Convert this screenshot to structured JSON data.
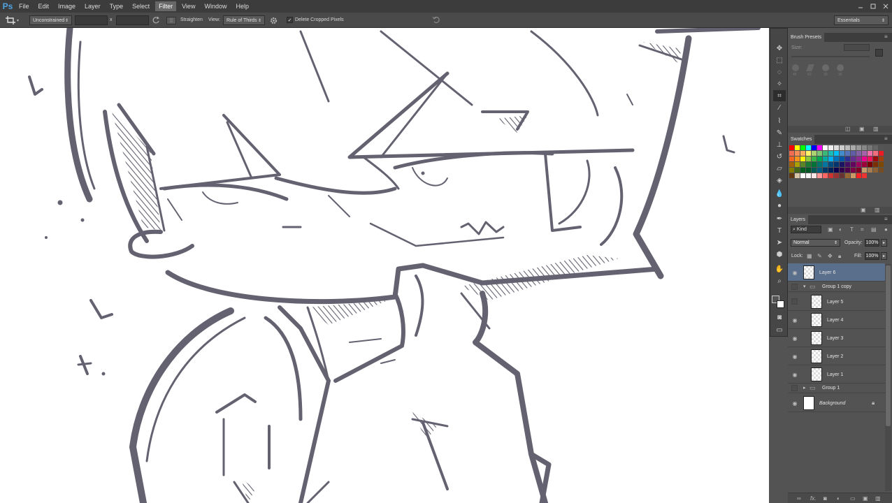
{
  "app": {
    "logo": "Ps",
    "menu": [
      "File",
      "Edit",
      "Image",
      "Layer",
      "Type",
      "Select",
      "Filter",
      "View",
      "Window",
      "Help"
    ],
    "active_menu": "Filter",
    "window_controls": [
      "minimize-icon",
      "maximize-icon",
      "close-icon"
    ]
  },
  "options_bar": {
    "tool_icon": "crop-icon",
    "ratio": "Unconstrained",
    "swap_symbol": "x",
    "straighten_icon_label": "░",
    "straighten_label": "Straighten",
    "view_label": "View:",
    "view_value": "Rule of Thirds",
    "delete_cropped_label": "Delete Cropped Pixels",
    "delete_cropped_checked": true,
    "workspace": "Essentials"
  },
  "brush_presets": {
    "tab": "Brush Presets",
    "size_label": "Size:",
    "presets": [
      "45",
      "60",
      "30",
      "30"
    ]
  },
  "swatches": {
    "tab": "Swatches",
    "colors": [
      "#ff0000",
      "#ffff00",
      "#00ff00",
      "#00ffff",
      "#0000ff",
      "#ff00ff",
      "#ffffff",
      "#eeeeee",
      "#dddddd",
      "#cccccc",
      "#bbbbbb",
      "#aaaaaa",
      "#999999",
      "#888888",
      "#777777",
      "#666666",
      "#555555",
      "#f26c4f",
      "#f68e56",
      "#fbaf5c",
      "#fff467",
      "#acd372",
      "#7cc576",
      "#3bb878",
      "#1abbb4",
      "#00bff3",
      "#438ccb",
      "#5574b9",
      "#605ca8",
      "#855fa8",
      "#a763a8",
      "#f06ea9",
      "#f26d7d",
      "#ed1c24",
      "#f26522",
      "#f7941d",
      "#fff200",
      "#8dc63f",
      "#39b54a",
      "#00a651",
      "#00a99d",
      "#00aeef",
      "#0072bc",
      "#0054a6",
      "#2e3192",
      "#662d91",
      "#92278f",
      "#ec008c",
      "#ed145b",
      "#9e0b0f",
      "#a0410d",
      "#a3620a",
      "#aba000",
      "#598527",
      "#1a7b30",
      "#007236",
      "#00746b",
      "#0076a3",
      "#004a80",
      "#003471",
      "#1b1464",
      "#440e62",
      "#630460",
      "#9e005d",
      "#9e0039",
      "#790000",
      "#7b2e00",
      "#7d4900",
      "#827b00",
      "#406618",
      "#005e20",
      "#005826",
      "#005952",
      "#005b7f",
      "#003663",
      "#002157",
      "#0d004c",
      "#32004b",
      "#4b0049",
      "#7b0046",
      "#7a0026",
      "#c69c6d",
      "#a67c52",
      "#8c6239",
      "#754c24",
      "#603913",
      "#d9c6a6",
      "#ffffff",
      "#f5f5f5",
      "#ffe5e5",
      "#ff9999",
      "#ff6666",
      "#cc3333",
      "#993333",
      "#663333",
      "#996633",
      "#cc9966",
      "#ff2222",
      "#ee3333"
    ]
  },
  "layers_panel": {
    "tab": "Layers",
    "kind_label": "Kind",
    "blend_mode": "Normal",
    "opacity_label": "Opacity:",
    "opacity_value": "100%",
    "lock_label": "Lock:",
    "fill_label": "Fill:",
    "fill_value": "100%",
    "layers": [
      {
        "name": "Layer 6",
        "visible": true,
        "selected": true,
        "indent": 0,
        "kind": "layer"
      },
      {
        "name": "Group 1 copy",
        "visible": false,
        "selected": false,
        "indent": 0,
        "kind": "group-open"
      },
      {
        "name": "Layer 5",
        "visible": false,
        "selected": false,
        "indent": 1,
        "kind": "layer"
      },
      {
        "name": "Layer 4",
        "visible": true,
        "selected": false,
        "indent": 1,
        "kind": "layer"
      },
      {
        "name": "Layer 3",
        "visible": true,
        "selected": false,
        "indent": 1,
        "kind": "layer"
      },
      {
        "name": "Layer 2",
        "visible": true,
        "selected": false,
        "indent": 1,
        "kind": "layer"
      },
      {
        "name": "Layer 1",
        "visible": true,
        "selected": false,
        "indent": 1,
        "kind": "layer"
      },
      {
        "name": "Group 1",
        "visible": false,
        "selected": false,
        "indent": 0,
        "kind": "group-closed"
      },
      {
        "name": "Background",
        "visible": true,
        "selected": false,
        "indent": 0,
        "kind": "background"
      }
    ],
    "footer_icons": [
      "link-icon",
      "fx-icon",
      "mask-icon",
      "adjustment-icon",
      "folder-icon",
      "new-layer-icon",
      "trash-icon"
    ],
    "footer_fx": "fx."
  },
  "colors": {
    "sketch_stroke": "#646270",
    "menubar_bg": "#3c3c3c",
    "panel_bg": "#535353",
    "selected_layer": "#596f8c"
  }
}
